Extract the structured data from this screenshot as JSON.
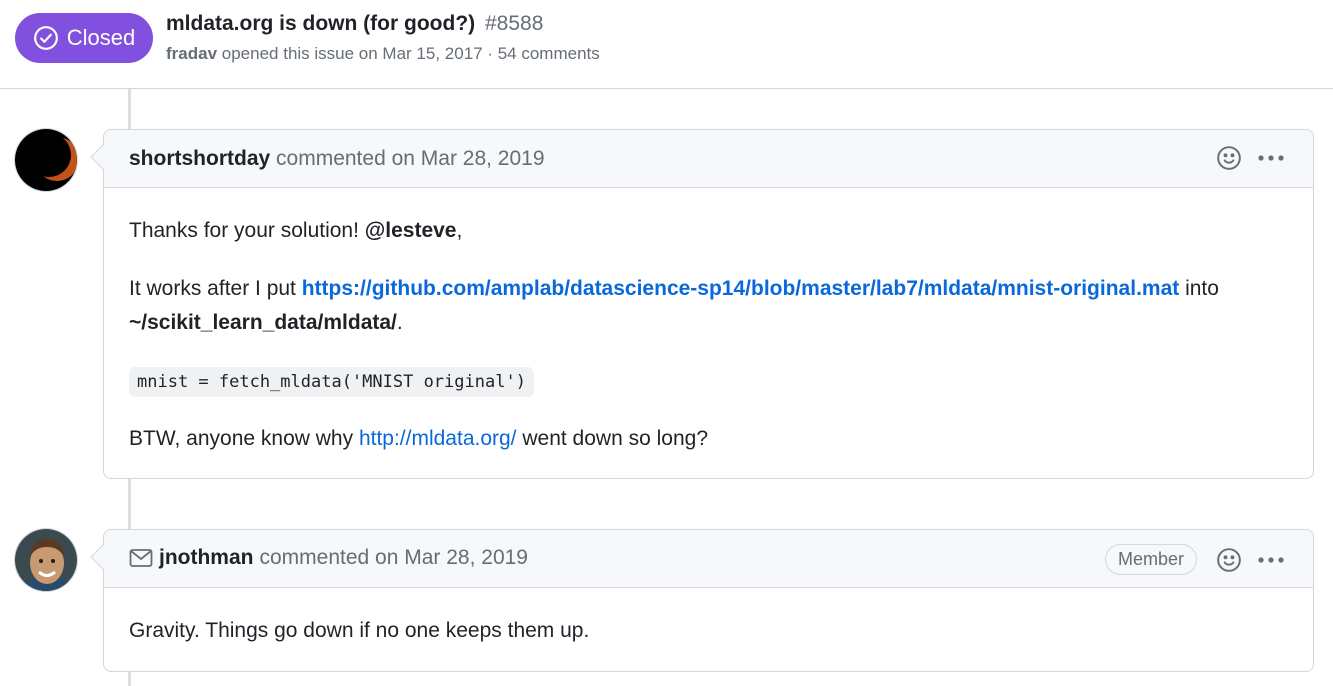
{
  "issue": {
    "state": "Closed",
    "title": "mldata.org is down (for good?)",
    "number": "#8588",
    "author": "fradav",
    "meta_rest": "opened this issue on Mar 15, 2017 · 54 comments"
  },
  "comments": [
    {
      "login": "shortshortday",
      "action": "commented on Mar 28, 2019",
      "body": {
        "p1_text": "Thanks for your solution! ",
        "p1_mention": "@lesteve",
        "p1_tail": ",",
        "p2_text": "It works after I put ",
        "p2_link": "https://github.com/amplab/datascience-sp14/blob/master/lab7/mldata/mnist-original.mat",
        "p2_mid": " into",
        "p2_path": "~/scikit_learn_data/mldata/",
        "p2_tail": ".",
        "code": "mnist = fetch_mldata('MNIST original')",
        "p3_text": "BTW, anyone know why ",
        "p3_link": "http://mldata.org/",
        "p3_tail": " went down so long?"
      }
    },
    {
      "login": "jnothman",
      "action": "commented on Mar 28, 2019",
      "role": "Member",
      "body": {
        "p1_text": "Gravity. Things go down if no one keeps them up."
      }
    }
  ],
  "icons": {
    "state": "check-circle-icon",
    "reaction": "smiley-icon",
    "menu": "kebab-horizontal-icon",
    "email": "mail-icon"
  },
  "colors": {
    "closed": "#8250df",
    "link": "#0969da",
    "border": "#d0d7de",
    "header_bg": "#f6f8fa"
  }
}
